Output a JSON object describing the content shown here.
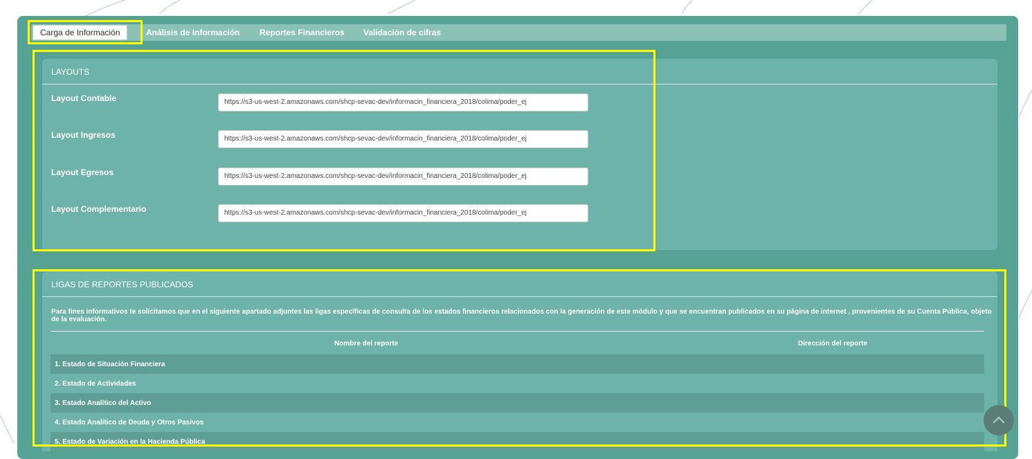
{
  "tabs": [
    {
      "label": "Carga de Información",
      "active": true
    },
    {
      "label": "Análisis de Información",
      "active": false
    },
    {
      "label": "Reportes Financieros",
      "active": false
    },
    {
      "label": "Validación de cifras",
      "active": false
    }
  ],
  "layouts": {
    "title": "LAYOUTS",
    "rows": [
      {
        "label": "Layout Contable",
        "value": "https://s3-us-west-2.amazonaws.com/shcp-sevac-dev/informacin_financiera_2018/colima/poder_ej"
      },
      {
        "label": "Layout Ingresos",
        "value": "https://s3-us-west-2.amazonaws.com/shcp-sevac-dev/informacin_financiera_2018/colima/poder_ej"
      },
      {
        "label": "Layout Egresos",
        "value": "https://s3-us-west-2.amazonaws.com/shcp-sevac-dev/informacin_financiera_2018/colima/poder_ej"
      },
      {
        "label": "Layout Complementario",
        "value": "https://s3-us-west-2.amazonaws.com/shcp-sevac-dev/informacin_financiera_2018/colima/poder_ej"
      }
    ]
  },
  "ligas": {
    "title": "LIGAS DE REPORTES PUBLICADOS",
    "description": "Para fines informativos te solicitamos que en el siguiente apartado adjuntes las ligas específicas de consulta de los estados financieros relacionados con la generación de este módulo y que se encuentran publicados en su página de internet , provenientes de su Cuenta Pública, objeto de la evaluación.",
    "columns": [
      "Nombre del reporte",
      "Dirección del reporte"
    ],
    "rows": [
      "1. Estado de Situación Financiera",
      "2. Estado de Actividades",
      "3. Estado Analítico del Activo",
      "4. Estado Analítico de Deuda y Otros Pasivos",
      "5. Estado de Variación en la Hacienda Pública"
    ]
  },
  "scroll_top_icon": "chevron-up-icon",
  "colors": {
    "panel": "#56a396",
    "card": "#6eb3a9",
    "highlight": "#ffff00",
    "row_alt": "#5f9e95"
  }
}
